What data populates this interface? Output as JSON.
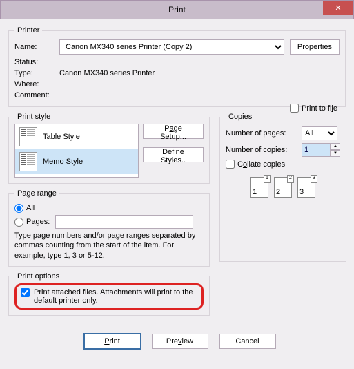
{
  "titlebar": {
    "title": "Print",
    "close": "✕"
  },
  "printer": {
    "legend": "Printer",
    "name_label": "Name:",
    "name_value": "Canon MX340 series Printer (Copy 2)",
    "properties_btn": "Properties",
    "status_label": "Status:",
    "status_value": "",
    "type_label": "Type:",
    "type_value": "Canon MX340 series Printer",
    "where_label": "Where:",
    "where_value": "",
    "comment_label": "Comment:",
    "comment_value": "",
    "print_to_file_label": "Print to file"
  },
  "print_style": {
    "legend": "Print style",
    "items": [
      {
        "label": "Table Style"
      },
      {
        "label": "Memo Style"
      }
    ],
    "page_setup_btn": "Page Setup...",
    "define_styles_btn": "Define Styles.."
  },
  "copies": {
    "legend": "Copies",
    "num_pages_label": "Number of pages:",
    "num_pages_value": "All",
    "num_copies_label": "Number of copies:",
    "num_copies_value": "1",
    "collate_label": "Collate copies",
    "pic1_sub": "1",
    "pic1_sup": "1",
    "pic2_sub": "2",
    "pic2_sup": "2",
    "pic3_sub": "3",
    "pic3_sup": "3"
  },
  "page_range": {
    "legend": "Page range",
    "all_label": "All",
    "pages_label": "Pages:",
    "hint": "Type page numbers and/or page ranges separated by commas counting from the start of the item.  For example, type 1, 3 or 5-12."
  },
  "print_options": {
    "legend": "Print options",
    "attach_label": "Print attached files.  Attachments will print to the default printer only."
  },
  "footer": {
    "print": "Print",
    "preview": "Preview",
    "cancel": "Cancel"
  }
}
